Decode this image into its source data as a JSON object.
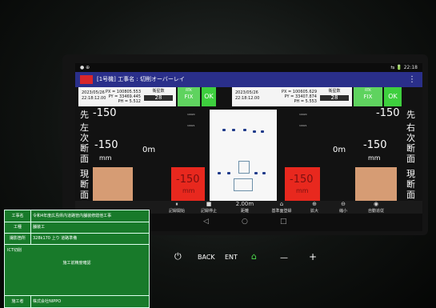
{
  "status": {
    "left": "● ⊕",
    "right": "⇆ 🔋 22:18"
  },
  "app": {
    "title": "[1号機] 工事名 : 切削オーバーレイ",
    "menu": "⋮"
  },
  "left_info": {
    "date": "2023/05/26",
    "time": "22:18:12.00",
    "px": "PX = 100805.553",
    "py": "PY = 33469.445",
    "pz": "PH = 5.512",
    "count_label": "衛星数",
    "count": "28"
  },
  "right_info": {
    "date": "2023/05/26",
    "time": "22:18:12.00",
    "px": "PX = 100605.629",
    "py": "PY = 33407.874",
    "pz": "PH = 5.553",
    "count_label": "衛星数",
    "count": "28"
  },
  "fix": {
    "small": "RTK",
    "label": "FIX"
  },
  "ok": "OK",
  "left": {
    "pos_label": "先",
    "pos_label2": "左",
    "value": "-150",
    "next_section": "次断面",
    "next_value": "-150",
    "next_unit": "mm",
    "distance": "0m",
    "current_section": "現断面",
    "current_value": "-150",
    "current_unit": "mm"
  },
  "right": {
    "pos_label": "先",
    "pos_label2": "右",
    "value": "-150",
    "next_section": "次断面",
    "next_value": "-150",
    "next_unit": "mm",
    "distance": "0m",
    "current_section": "現断面",
    "current_value": "-150",
    "current_unit": "mm"
  },
  "center_ticks": [
    "10020",
    "10021",
    "10020",
    "10021"
  ],
  "tools": [
    {
      "icon": "⏸",
      "label": "記録開始"
    },
    {
      "icon": "■",
      "label": "記録停止"
    },
    {
      "icon": "2.00m",
      "label": "距離"
    },
    {
      "icon": "⌂",
      "label": "基準面登録"
    },
    {
      "icon": "⊕",
      "label": "拡大"
    },
    {
      "icon": "⊖",
      "label": "縮小"
    },
    {
      "icon": "◉",
      "label": "自動追従"
    }
  ],
  "nav": {
    "back": "◁",
    "home": "○",
    "recent": "□"
  },
  "hardware": {
    "power": "⏻",
    "back": "BACK",
    "enter": "ENT",
    "home": "⌂",
    "minus": "—",
    "plus": "+"
  },
  "board": {
    "rows": [
      {
        "k": "工事名",
        "v": "令和4年度広島県内道路管内舗装修繕他工事"
      },
      {
        "k": "工種",
        "v": "舗装工"
      },
      {
        "k": "撮影箇所",
        "v": "328k170 上り 道路準備"
      }
    ],
    "section_label": "ICT切削",
    "section_text": "施工前精度確認",
    "builder_label": "施工者",
    "builder": "株式会社NIPPO"
  },
  "colors": {
    "accent": "#2a2f8a",
    "alert": "#e8281e",
    "ok": "#3ecf3e",
    "board": "#187a2a",
    "tan": "#d69c74"
  }
}
